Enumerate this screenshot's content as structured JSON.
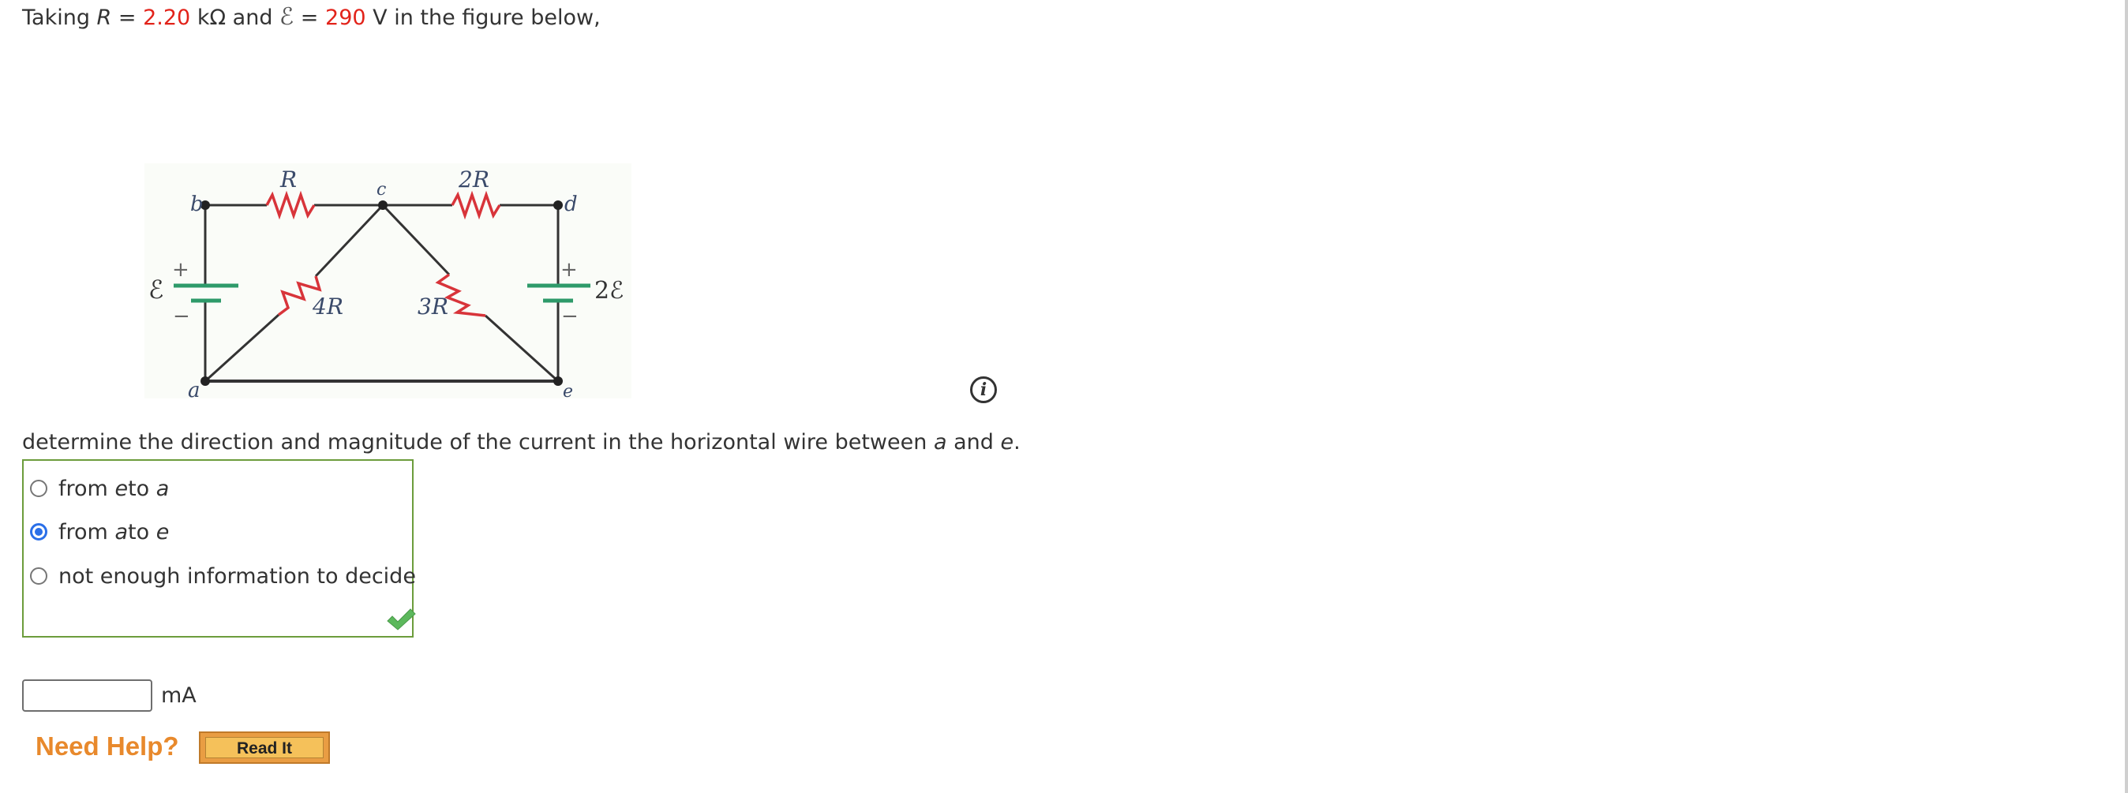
{
  "heading": {
    "prefix": "Taking ",
    "r_symbol": "R",
    "equals1": " = ",
    "r_value": "2.20",
    "r_unit": " kΩ and ",
    "emf_symbol": "ℰ",
    "equals2": " = ",
    "emf_value": "290",
    "suffix": " V in the figure below,"
  },
  "figure": {
    "labels": {
      "node_b": "b",
      "node_c": "c",
      "node_d": "d",
      "node_a": "a",
      "node_e": "e",
      "res_top_left": "R",
      "res_top_right": "2R",
      "res_diag_left": "4R",
      "res_diag_right": "3R",
      "battery_left": "ℰ",
      "battery_right": "2ℰ",
      "plus": "+",
      "minus": "−"
    },
    "colors": {
      "wire": "#333333",
      "resistor": "#d8343a",
      "battery": "#2e9a6a",
      "label": "#3a4a6a"
    }
  },
  "info_icon": {
    "glyph": "i"
  },
  "question": {
    "text1": "determine the direction and magnitude of the current in the horizontal wire between ",
    "var_a": "a",
    "and": " and ",
    "var_e": "e",
    "end": "."
  },
  "choices": [
    {
      "pre": "from ",
      "v1": "e",
      "mid": " to ",
      "v2": "a",
      "selected": false
    },
    {
      "pre": "from ",
      "v1": "a",
      "mid": " to ",
      "v2": "e",
      "selected": true
    },
    {
      "pre": "not enough information to decide",
      "v1": "",
      "mid": "",
      "v2": "",
      "selected": false
    }
  ],
  "status": {
    "correct": true,
    "check_color": "#5cb85c",
    "box_border_color": "#6c9c3c"
  },
  "answer": {
    "value": "",
    "placeholder": "",
    "unit": "mA"
  },
  "help": {
    "label": "Need Help?",
    "read_it": "Read It"
  }
}
